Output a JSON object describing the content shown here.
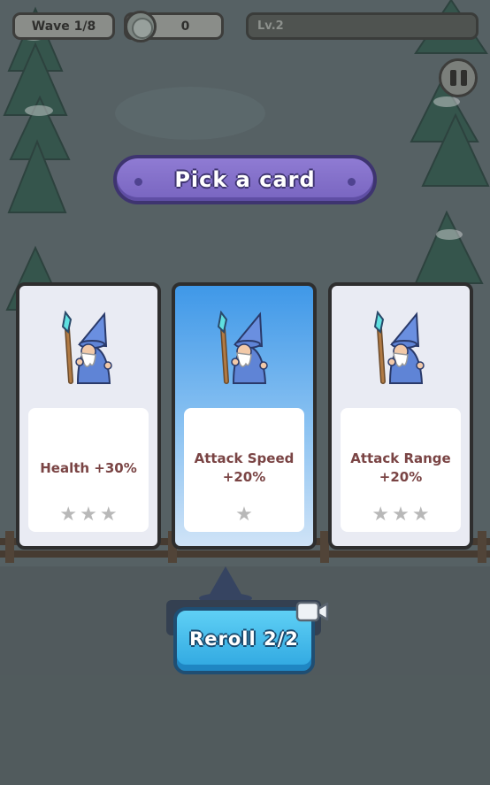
{
  "hud": {
    "wave_label": "Wave 1/8",
    "coins": "0",
    "level_label": "Lv.2"
  },
  "title": "Pick a card",
  "cards": [
    {
      "label": "Health +30%",
      "stars": 3,
      "highlighted": false
    },
    {
      "label": "Attack Speed\n+20%",
      "stars": 1,
      "highlighted": true
    },
    {
      "label": "Attack Range\n+20%",
      "stars": 3,
      "highlighted": false
    }
  ],
  "reroll": {
    "label": "Reroll 2/2"
  },
  "icons": {
    "coin": "coin-icon",
    "pause": "pause-icon",
    "wizard": "wizard-icon",
    "star": "star-icon",
    "video": "video-ad-icon"
  },
  "colors": {
    "title_banner": "#8f7bd3",
    "card_highlight": "#3f98e8",
    "card_label": "#7a4444",
    "reroll_button": "#3ab6ea",
    "star_inactive": "#b8b8b8"
  }
}
